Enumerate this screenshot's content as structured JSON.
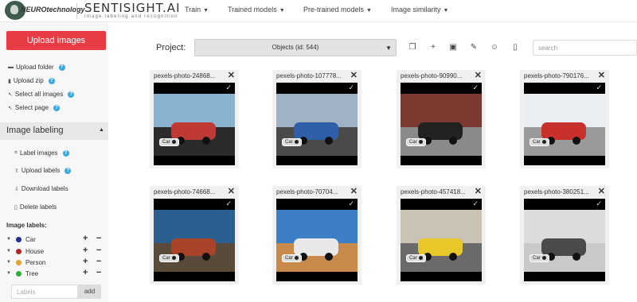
{
  "header": {
    "logo_text": "NEUROtechnology",
    "app_title": "SENTISIGHT.AI",
    "app_subtitle": "Image labeling and recognition",
    "menu": [
      {
        "label": "Train"
      },
      {
        "label": "Trained models"
      },
      {
        "label": "Pre-trained models"
      },
      {
        "label": "Image similarity"
      }
    ]
  },
  "sidebar": {
    "upload_button": "Upload images",
    "items": [
      {
        "label": "Upload folder",
        "icon": "folder-icon"
      },
      {
        "label": "Upload zip",
        "icon": "zip-icon"
      },
      {
        "label": "Select all images",
        "icon": "select-all-icon"
      },
      {
        "label": "Select page",
        "icon": "select-page-icon"
      }
    ],
    "section_title": "Image labeling",
    "labeling_items": [
      {
        "label": "Label images",
        "icon": "label-images-icon"
      },
      {
        "label": "Upload labels",
        "icon": "upload-icon"
      },
      {
        "label": "Download labels",
        "icon": "download-icon"
      },
      {
        "label": "Delete labels",
        "icon": "trash-icon"
      }
    ],
    "image_labels_title": "Image labels:",
    "labels": [
      {
        "name": "Car",
        "color": "#1f2f8f"
      },
      {
        "name": "House",
        "color": "#b2222b"
      },
      {
        "name": "Person",
        "color": "#e0a52e"
      },
      {
        "name": "Tree",
        "color": "#2fae3b"
      }
    ],
    "labels_input_placeholder": "Labels",
    "add_button": "add"
  },
  "main": {
    "project_label": "Project:",
    "project_value": "Objects (id: 544)",
    "search_placeholder": "search",
    "toolbar_icons": [
      "copy-icon",
      "plus-icon",
      "duplicate-icon",
      "edit-icon",
      "share-user-icon",
      "trash-icon"
    ],
    "cards": [
      {
        "name": "pexels-photo-24868...",
        "tag": "Car",
        "scene": [
          "#8ab3cf",
          "#c03a35",
          "#2b2b2b"
        ]
      },
      {
        "name": "pexels-photo-107778...",
        "tag": "Car",
        "scene": [
          "#9fb3c4",
          "#2f5fa8",
          "#4a4a4a"
        ]
      },
      {
        "name": "pexels-photo-90990...",
        "tag": "Car",
        "scene": [
          "#7a3a30",
          "#222222",
          "#8a8a8a"
        ]
      },
      {
        "name": "pexels-photo-790176...",
        "tag": "Car",
        "scene": [
          "#e8eef2",
          "#c8302c",
          "#9a9a9a"
        ]
      },
      {
        "name": "pexels-photo-74668...",
        "tag": "Car",
        "scene": [
          "#2a5f8f",
          "#a9432a",
          "#5a4a3a"
        ]
      },
      {
        "name": "pexels-photo-70704...",
        "tag": "Car",
        "scene": [
          "#3d7fc4",
          "#e8e8e8",
          "#c78a4a"
        ]
      },
      {
        "name": "pexels-photo-457418...",
        "tag": "Car",
        "scene": [
          "#c9c2b5",
          "#e8c72a",
          "#6a6a6a"
        ]
      },
      {
        "name": "pexels-photo-380251...",
        "tag": "Car",
        "scene": [
          "#dcdcdc",
          "#4a4a4a",
          "#c9c9c9"
        ]
      }
    ]
  }
}
